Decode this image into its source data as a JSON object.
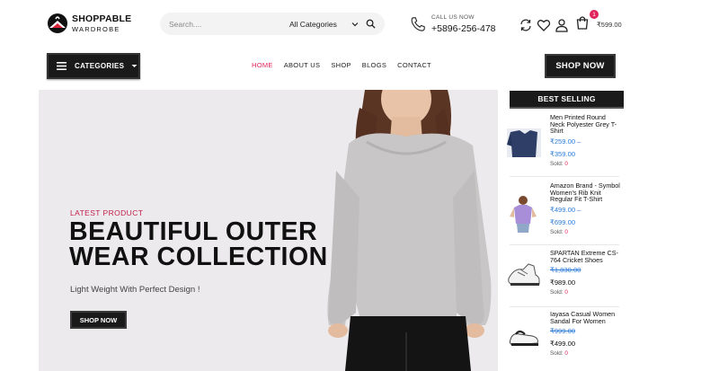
{
  "brand": {
    "name_line1": "SHOPPABLE",
    "name_line2": "WARDROBE"
  },
  "search": {
    "placeholder": "Search....",
    "category": "All Categories"
  },
  "call": {
    "label": "CALL US NOW",
    "number": "+5896-256-478"
  },
  "cart": {
    "count": "1",
    "total": "₹599.00"
  },
  "nav": {
    "categories_label": "CATEGORIES",
    "links": [
      "HOME",
      "ABOUT US",
      "SHOP",
      "BLOGS",
      "CONTACT"
    ],
    "active": "HOME",
    "shop_now": "SHOP NOW"
  },
  "hero": {
    "subtitle": "LATEST PRODUCT",
    "title": "BEAUTIFUL OUTER\nWEAR COLLECTION",
    "description": "Light Weight With Perfect Design !",
    "button": "SHOP NOW"
  },
  "best_selling": {
    "title": "BEST SELLING",
    "items": [
      {
        "name": "Men Printed Round Neck Polyester Grey T-Shirt",
        "price1": "₹259.00 –",
        "price2": "₹359.00",
        "sold_label": "Sold:",
        "sold": "0"
      },
      {
        "name": "Amazon Brand - Symbol Women's Rib Knit Regular Fit T-Shirt",
        "price1": "₹499.00 –",
        "price2": "₹699.00",
        "sold_label": "Sold:",
        "sold": "0"
      },
      {
        "name": "SPARTAN Extreme CS-764 Cricket Shoes",
        "price1": "₹1,830.00",
        "price2": "₹989.00",
        "sold_label": "Sold:",
        "sold": "0"
      },
      {
        "name": "Iayasa Casual Women Sandal For Women",
        "price1": "₹999.00",
        "price2": "₹499.00",
        "sold_label": "Sold:",
        "sold": "0"
      }
    ]
  },
  "colors": {
    "accent": "#e1245b",
    "price_blue": "#2d7bd8",
    "dark": "#1a1a1a",
    "hero_bg": "#eceaec"
  }
}
